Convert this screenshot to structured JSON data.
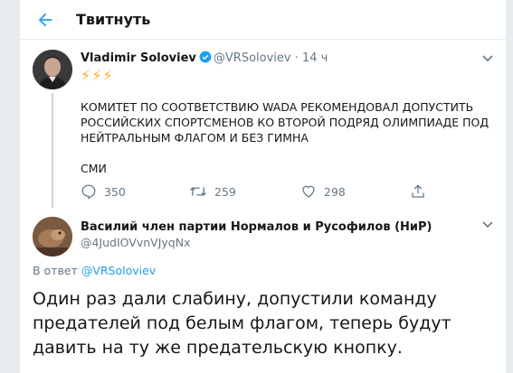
{
  "header": {
    "title": "Твитнуть",
    "back_icon": "arrow-left-icon"
  },
  "colors": {
    "accent": "#1da1f2",
    "verified": "#1da1f2",
    "muted": "#657786",
    "emoji": "#ffac33"
  },
  "original_tweet": {
    "author_name": "Vladimir Soloviev",
    "handle": "@VRSoloviev",
    "separator": "·",
    "time": "14 ч",
    "emoji": "⚡⚡⚡",
    "text": "КОМИТЕТ ПО СООТВЕТСТВИЮ WADA РЕКОМЕНДОВАЛ ДОПУСТИТЬ РОССИЙСКИХ СПОРТСМЕНОВ КО ВТОРОЙ ПОДРЯД ОЛИМПИАДЕ ПОД НЕЙТРАЛЬНЫМ ФЛАГОМ И БЕЗ ГИМНА",
    "source": "СМИ",
    "replies": "350",
    "retweets": "259",
    "likes": "298"
  },
  "reply_tweet": {
    "author_name": "Василий член партии Нормалов и Русофилов (НиР)",
    "handle": "@4JudIOVvnVJyqNx",
    "reply_to_label": "В ответ",
    "reply_to_handle": "@VRSoloviev",
    "text": "Один раз дали слабину, допустили команду предателей под белым флагом, теперь будут давить на ту же предательскую кнопку."
  }
}
